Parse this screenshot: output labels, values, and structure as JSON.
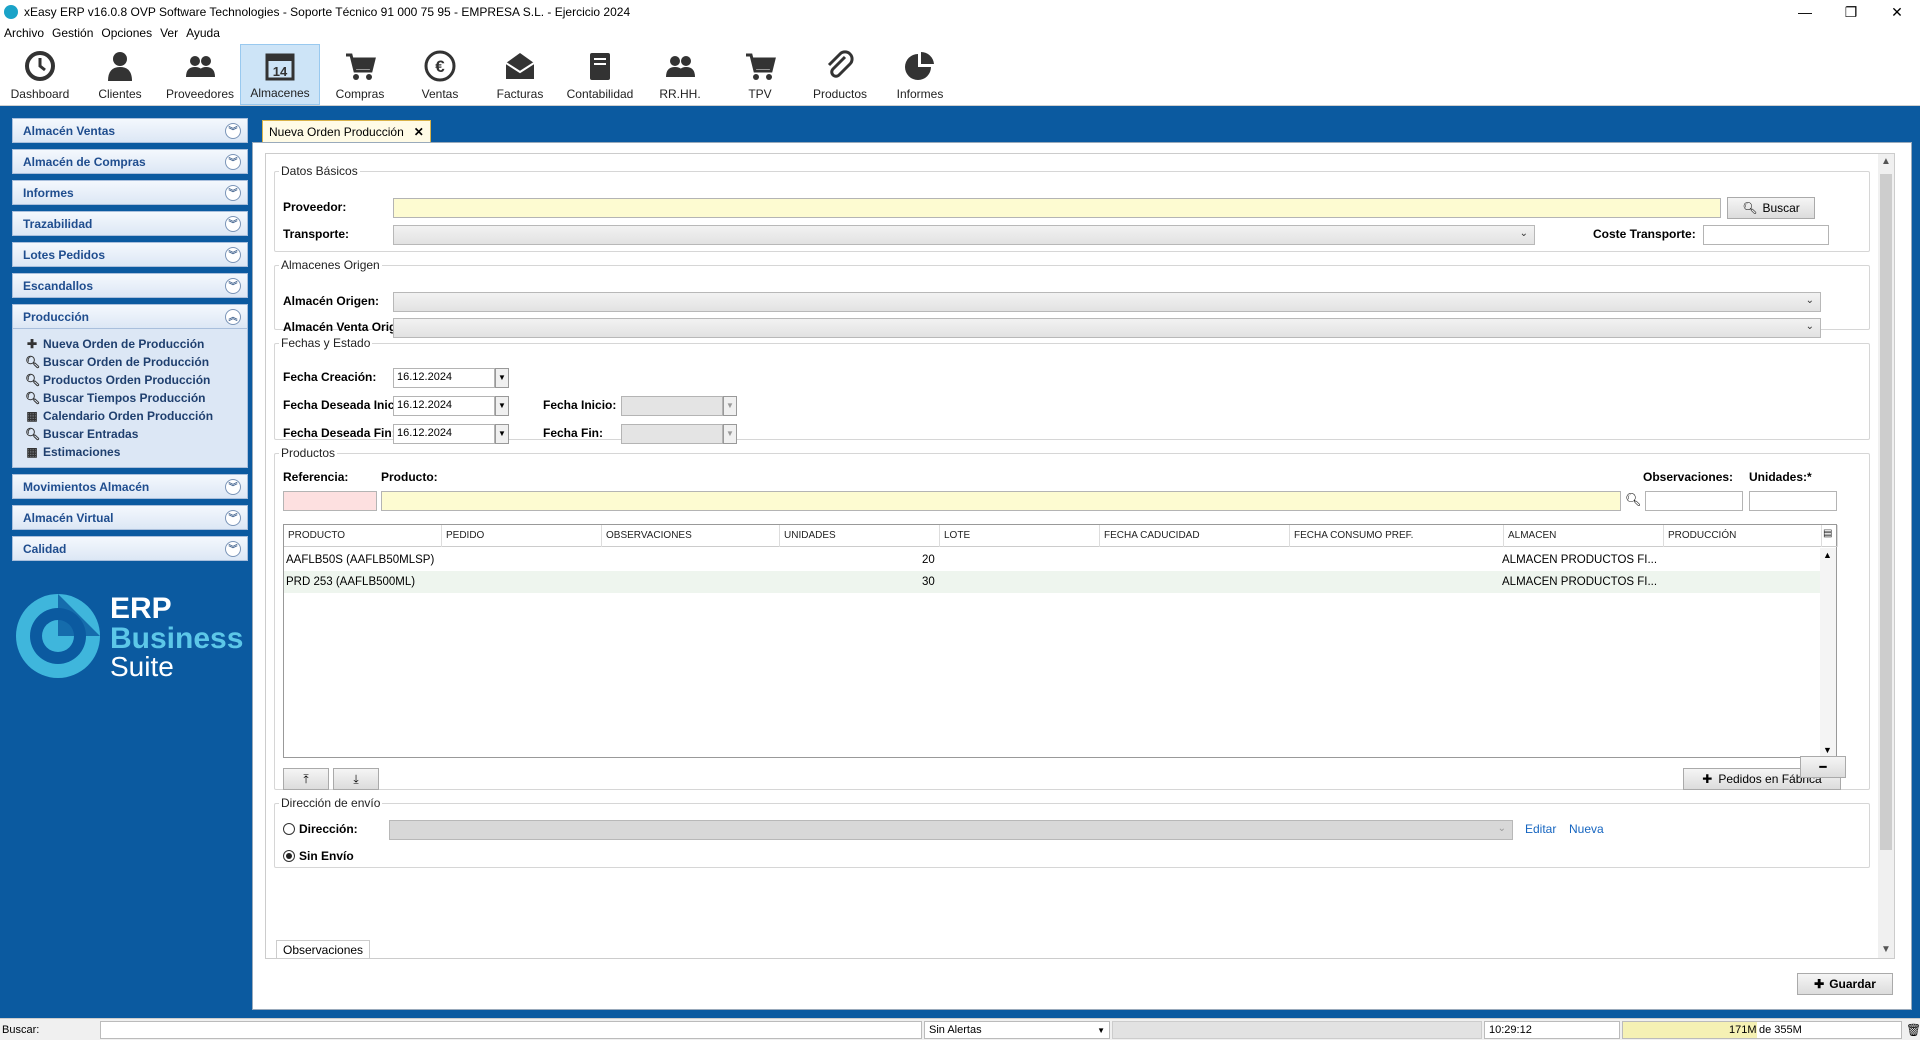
{
  "window": {
    "title": "xEasy ERP v16.0.8 OVP Software Technologies - Soporte Técnico 91 000 75 95 - EMPRESA S.L. - Ejercicio 2024",
    "minimize": "—",
    "restore": "❐",
    "close": "✕"
  },
  "menu": [
    "Archivo",
    "Gestión",
    "Opciones",
    "Ver",
    "Ayuda"
  ],
  "toolbar": [
    {
      "label": "Dashboard",
      "icon": "clock-icon",
      "active": false
    },
    {
      "label": "Clientes",
      "icon": "person-icon",
      "active": false
    },
    {
      "label": "Proveedores",
      "icon": "people-icon",
      "active": false
    },
    {
      "label": "Almacenes",
      "icon": "calendar-icon",
      "active": true
    },
    {
      "label": "Compras",
      "icon": "cart-icon",
      "active": false
    },
    {
      "label": "Ventas",
      "icon": "euro-icon",
      "active": false
    },
    {
      "label": "Facturas",
      "icon": "envelope-icon",
      "active": false
    },
    {
      "label": "Contabilidad",
      "icon": "book-icon",
      "active": false
    },
    {
      "label": "RR.HH.",
      "icon": "people-icon",
      "active": false
    },
    {
      "label": "TPV",
      "icon": "cart-icon",
      "active": false
    },
    {
      "label": "Productos",
      "icon": "paperclip-icon",
      "active": false
    },
    {
      "label": "Informes",
      "icon": "pie-chart-icon",
      "active": false
    }
  ],
  "sidebar": {
    "sections_top": [
      "Almacén Ventas",
      "Almacén de Compras",
      "Informes",
      "Trazabilidad",
      "Lotes Pedidos",
      "Escandallos"
    ],
    "open_section": "Producción",
    "open_items": [
      {
        "icon": "plus-icon",
        "glyph": "✚",
        "label": "Nueva Orden de Producción"
      },
      {
        "icon": "search-icon",
        "glyph": "🔍︎",
        "label": "Buscar Orden de Producción"
      },
      {
        "icon": "search-icon",
        "glyph": "🔍︎",
        "label": "Productos Orden Producción"
      },
      {
        "icon": "search-icon",
        "glyph": "🔍︎",
        "label": "Buscar Tiempos Producción"
      },
      {
        "icon": "calendar-icon",
        "glyph": "▦",
        "label": "Calendario Orden Producción"
      },
      {
        "icon": "search-icon",
        "glyph": "🔍︎",
        "label": "Buscar Entradas"
      },
      {
        "icon": "grid-icon",
        "glyph": "▦",
        "label": "Estimaciones"
      }
    ],
    "sections_bottom": [
      "Movimientos Almacén",
      "Almacén Virtual",
      "Calidad"
    ],
    "brand": {
      "line1": "ERP",
      "line2": "Business",
      "line3": "Suite"
    }
  },
  "tab": {
    "label": "Nueva Orden Producción",
    "close": "✕"
  },
  "datos_basicos": {
    "legend": "Datos Básicos",
    "proveedor_label": "Proveedor:",
    "proveedor_value": "",
    "buscar_label": "Buscar",
    "transporte_label": "Transporte:",
    "coste_label": "Coste Transporte:",
    "coste_value": ""
  },
  "almacenes_origen": {
    "legend": "Almacenes Origen",
    "origen_label": "Almacén Origen:",
    "venta_label": "Almacén Venta Origen:"
  },
  "fechas": {
    "legend": "Fechas y Estado",
    "creacion_label": "Fecha Creación:",
    "creacion_value": "16.12.2024",
    "deseada_inicio_label": "Fecha Deseada Inicio:",
    "deseada_inicio_value": "16.12.2024",
    "inicio_label": "Fecha Inicio:",
    "inicio_value": "",
    "deseada_fin_label": "Fecha Deseada Fin:",
    "deseada_fin_value": "16.12.2024",
    "fin_label": "Fecha Fin:",
    "fin_value": ""
  },
  "productos": {
    "legend": "Productos",
    "referencia_label": "Referencia:",
    "producto_label": "Producto:",
    "observaciones_label": "Observaciones:",
    "unidades_label": "Unidades:*",
    "columns": [
      "PRODUCTO",
      "PEDIDO",
      "OBSERVACIONES",
      "UNIDADES",
      "LOTE",
      "FECHA CADUCIDAD",
      "FECHA CONSUMO PREF.",
      "ALMACEN",
      "PRODUCCIÓN"
    ],
    "rows": [
      {
        "producto": "AAFLB50S (AAFLB50MLSP)",
        "pedido": "",
        "observaciones": "",
        "unidades": "20",
        "lote": "",
        "fecha_caducidad": "",
        "fecha_consumo": "",
        "almacen": "ALMACEN PRODUCTOS FI...",
        "produccion": ""
      },
      {
        "producto": "PRD 253 (AAFLB500ML)",
        "pedido": "",
        "observaciones": "",
        "unidades": "30",
        "lote": "",
        "fecha_caducidad": "",
        "fecha_consumo": "",
        "almacen": "ALMACEN PRODUCTOS FI...",
        "produccion": ""
      }
    ],
    "pedidos_fabrica_label": "Pedidos en Fábrica"
  },
  "direccion": {
    "legend": "Dirección de envío",
    "direccion_label": "Dirección:",
    "editar": "Editar",
    "nueva": "Nueva",
    "sin_envio_label": "Sin Envío",
    "selected": "sin_envio"
  },
  "observaciones_tab": "Observaciones",
  "guardar_label": "Guardar",
  "status": {
    "buscar_label": "Buscar:",
    "buscar_value": "",
    "alertas": "Sin Alertas",
    "time": "10:29:12",
    "mem_used": "171M",
    "mem_total": "de 355M"
  },
  "colors": {
    "frame": "#0b5aa0",
    "accent_link": "#1565c0",
    "required": "#fdfbd1"
  }
}
